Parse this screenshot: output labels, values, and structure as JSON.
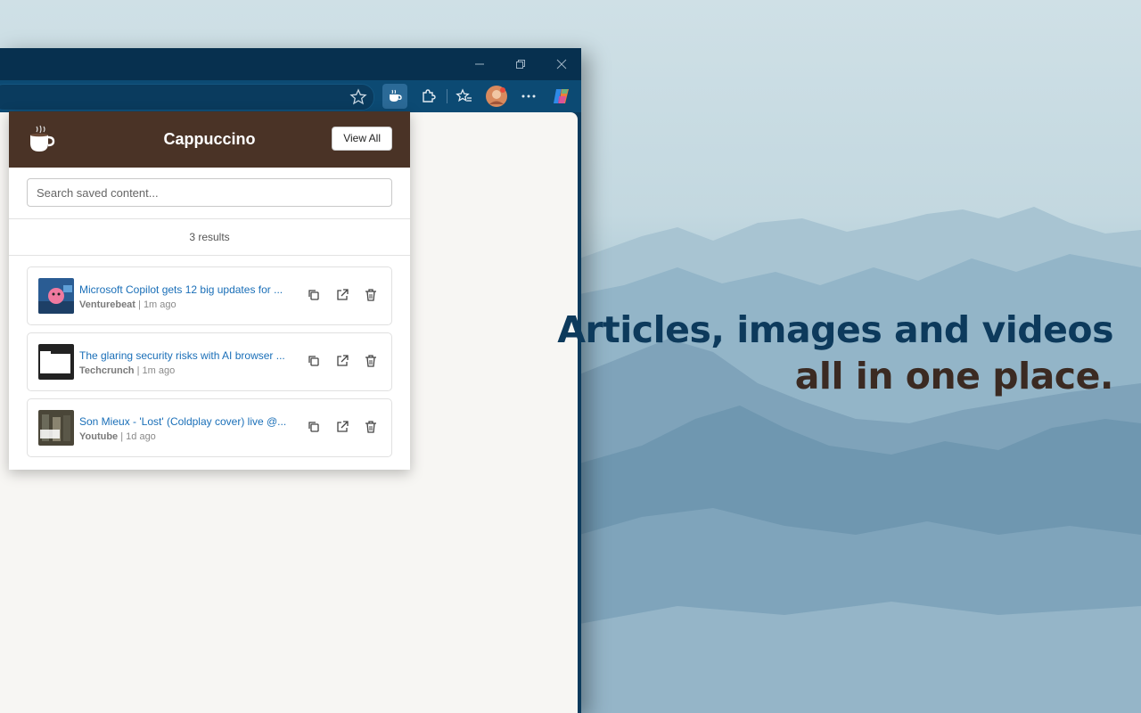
{
  "popup": {
    "title": "Cappuccino",
    "view_all_label": "View All",
    "search_placeholder": "Search saved content...",
    "results_count": "3 results",
    "items": [
      {
        "title": "Microsoft Copilot gets 12 big updates for ...",
        "source": "Venturebeat",
        "time": " | 1m ago"
      },
      {
        "title": "The glaring security risks with AI browser ...",
        "source": "Techcrunch",
        "time": " | 1m ago"
      },
      {
        "title": "Son Mieux - 'Lost' (Coldplay cover) live @...",
        "source": "Youtube",
        "time": " | 1d ago"
      }
    ]
  },
  "tagline": {
    "line1": "Articles, images and videos",
    "line2": "all in one place."
  },
  "colors": {
    "popup_header": "#4a3326",
    "link": "#1a6fb8",
    "browser_frame": "#0b3a5c"
  },
  "icons": [
    "minimize-icon",
    "restore-icon",
    "close-icon",
    "star-icon",
    "cappuccino-extension-icon",
    "extensions-icon",
    "favorites-icon",
    "profile-avatar",
    "more-icon",
    "copilot-icon",
    "copy-icon",
    "open-external-icon",
    "delete-icon"
  ]
}
